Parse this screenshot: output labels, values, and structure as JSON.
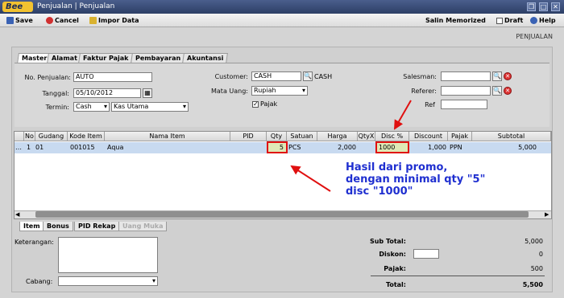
{
  "app": {
    "logo": "Bee",
    "title": "Penjualan | Penjualan"
  },
  "toolbar": {
    "save": "Save",
    "cancel": "Cancel",
    "import": "Impor Data",
    "salin": "Salin Memorized",
    "draft": "Draft",
    "help": "Help"
  },
  "page_heading": "PENJUALAN",
  "tabs": [
    "Master",
    "Alamat",
    "Faktur Pajak",
    "Pembayaran",
    "Akuntansi"
  ],
  "form": {
    "no_penjualan_label": "No. Penjualan:",
    "no_penjualan": "AUTO",
    "tanggal_label": "Tanggal:",
    "tanggal": "05/10/2012",
    "termin_label": "Termin:",
    "termin": "Cash",
    "kas": "Kas Utama",
    "customer_label": "Customer:",
    "customer": "CASH",
    "customer_name": "CASH",
    "mata_uang_label": "Mata Uang:",
    "mata_uang": "Rupiah",
    "pajak_label": "Pajak",
    "salesman_label": "Salesman:",
    "referer_label": "Referer:",
    "ref_label": "Ref"
  },
  "grid": {
    "headers": [
      "No",
      "Gudang",
      "Kode Item",
      "Nama Item",
      "PID",
      "Qty",
      "Satuan",
      "Harga",
      "QtyX",
      "Disc %",
      "Discount",
      "Pajak",
      "Subtotal"
    ],
    "rows": [
      {
        "no": "1",
        "gudang": "01",
        "kode": "001015",
        "nama": "Aqua",
        "pid": "",
        "qty": "5",
        "satuan": "PCS",
        "harga": "2,000",
        "qtyx": "",
        "disc": "1000",
        "discount": "1,000",
        "pajak": "PPN",
        "subtotal": "5,000"
      }
    ]
  },
  "annotation": {
    "line1": "Hasil dari promo,",
    "line2": "dengan minimal qty \"5\"",
    "line3": "disc \"1000\""
  },
  "bottom_tabs": [
    "Item",
    "Bonus",
    "PID Rekap",
    "Uang Muka"
  ],
  "footer": {
    "keterangan_label": "Keterangan:",
    "cabang_label": "Cabang:",
    "subtotal_label": "Sub Total:",
    "subtotal": "5,000",
    "diskon_label": "Diskon:",
    "diskon": "0",
    "pajak_label": "Pajak:",
    "pajak": "500",
    "total_label": "Total:",
    "total": "5,500"
  },
  "colors": {
    "titlebar": "#2d3f66",
    "highlight": "#e01010",
    "annotation": "#1f2fd0"
  }
}
